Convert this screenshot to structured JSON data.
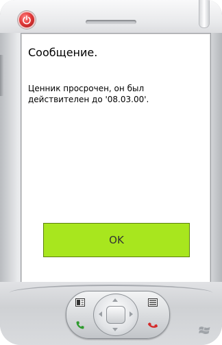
{
  "dialog": {
    "title": "Сообщение.",
    "message": "Ценник просрочен, он был действителен до '08.03.00'.",
    "ok_label": "OK"
  },
  "colors": {
    "ok_button": "#a8e61e",
    "screen_background": "#ffffff",
    "power_button": "#e43b3b",
    "call_key": "#2e9a2e",
    "end_key": "#d42a2a"
  },
  "icons": {
    "power": "power-icon",
    "softkey_left": "left-softkey-icon",
    "softkey_right": "right-softkey-icon",
    "call": "phone-call-icon",
    "end": "phone-end-icon",
    "windows": "windows-logo-icon"
  }
}
